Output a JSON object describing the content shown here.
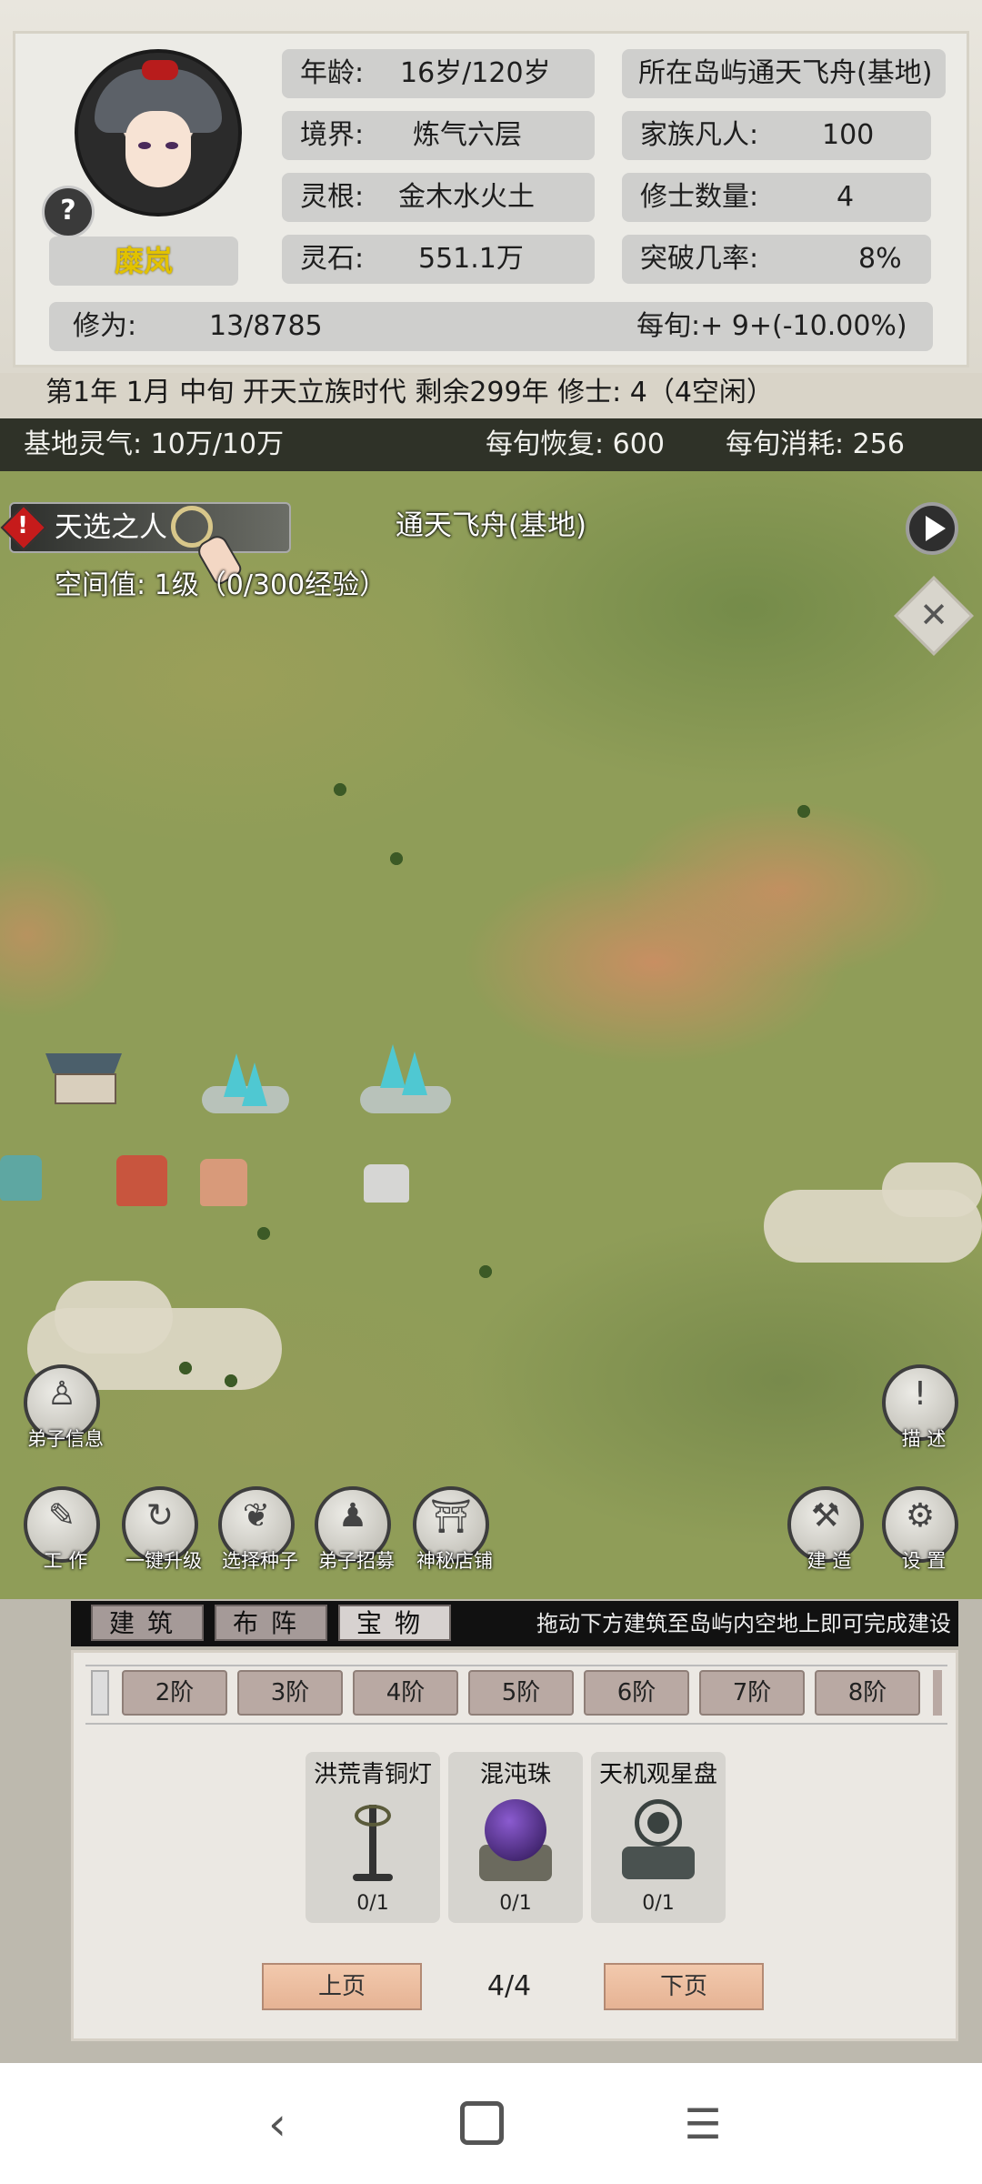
{
  "player": {
    "name": "糜岚",
    "help_icon": "question-mark",
    "age_label": "年龄:",
    "age_value": "16岁/120岁",
    "realm_label": "境界:",
    "realm_value": "炼气六层",
    "root_label": "灵根:",
    "root_value": "金木水火土",
    "stone_label": "灵石:",
    "stone_value": "551.1万",
    "cultivation_label": "修为:",
    "cultivation_value": "13/8785"
  },
  "clan": {
    "island_label": "所在岛屿",
    "island_value": "通天飞舟(基地)",
    "mortals_label": "家族凡人:",
    "mortals_value": "100",
    "cultivators_label": "修士数量:",
    "cultivators_value": "4",
    "breakthrough_label": "突破几率:",
    "breakthrough_value": "8%",
    "per_turn": "每旬:+ 9+(-10.00%)"
  },
  "status_line": "第1年 1月 中旬  开天立族时代 剩余299年  修士: 4（4空闲）",
  "aura": {
    "base_label": "基地灵气: 10万/10万",
    "recover_label": "每旬恢复: 600",
    "consume_label": "每旬消耗: 256"
  },
  "map": {
    "title": "通天飞舟(基地)",
    "skill_label": "天选之人",
    "space_label": "空间值: 1级（0/300经验）"
  },
  "buttons": {
    "disciple_info": "弟子信息",
    "describe": "描 述",
    "work": "工 作",
    "upgrade_all": "一键升级",
    "choose_seed": "选择种子",
    "recruit": "弟子招募",
    "shop": "神秘店铺",
    "build": "建 造",
    "settings": "设 置"
  },
  "tabs": [
    "建筑",
    "布阵",
    "宝物"
  ],
  "hint": "拖动下方建筑至岛屿内空地上即可完成建设",
  "grades": [
    "2阶",
    "3阶",
    "4阶",
    "5阶",
    "6阶",
    "7阶",
    "8阶"
  ],
  "items": [
    {
      "name": "洪荒青铜灯",
      "count": "0/1"
    },
    {
      "name": "混沌珠",
      "count": "0/1"
    },
    {
      "name": "天机观星盘",
      "count": "0/1"
    }
  ],
  "pager": {
    "prev": "上页",
    "next": "下页",
    "page": "4/4"
  },
  "colors": {
    "accent_name": "#e2c200",
    "aura_bar": "#2f3228",
    "map_grass": "#8f9d58",
    "map_dirt": "#d28c64"
  }
}
